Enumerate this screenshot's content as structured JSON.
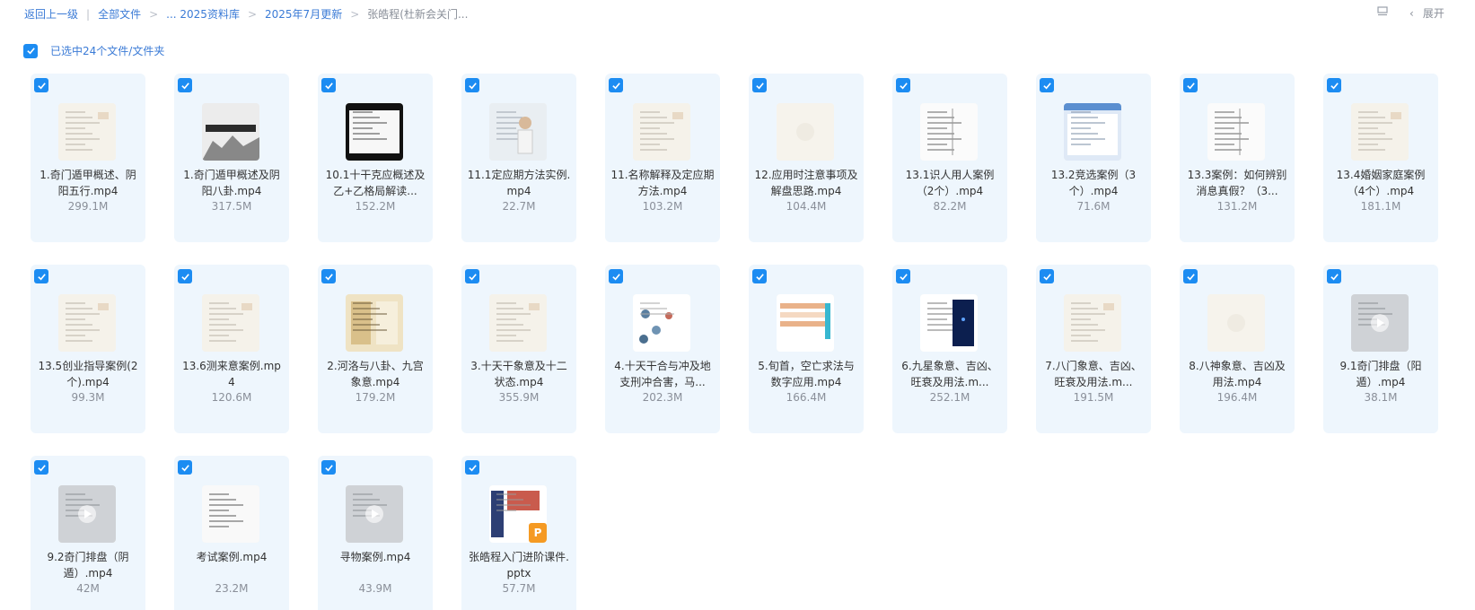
{
  "breadcrumb": {
    "back": "返回上一级",
    "items": [
      "全部文件",
      "... 2025资料库",
      "2025年7月更新"
    ],
    "current": "张皓程(杜新会关门..."
  },
  "toolbar": {
    "expand_label": "展开",
    "view_icon": "list-view-icon",
    "collapse_icon": "chevron-left-icon"
  },
  "selection": {
    "label": "已选中24个文件/文件夹"
  },
  "colors": {
    "accent": "#1c8cf2",
    "card_bg": "#eef6fd",
    "link": "#3b7bd6"
  },
  "files": [
    {
      "name": "1.奇门遁甲概述、阴阳五行.mp4",
      "size": "299.1M",
      "thumb": "doc"
    },
    {
      "name": "1.奇门遁甲概述及阴阳八卦.mp4",
      "size": "317.5M",
      "thumb": "title"
    },
    {
      "name": "10.1十干克应概述及乙+乙格局解读...",
      "size": "152.2M",
      "thumb": "dark"
    },
    {
      "name": "11.1定应期方法实例.mp4",
      "size": "22.7M",
      "thumb": "person"
    },
    {
      "name": "11.名称解释及定应期方法.mp4",
      "size": "103.2M",
      "thumb": "doc"
    },
    {
      "name": "12.应用时注意事项及解盘思路.mp4",
      "size": "104.4M",
      "thumb": "blank"
    },
    {
      "name": "13.1识人用人案例（2个）.mp4",
      "size": "82.2M",
      "thumb": "table"
    },
    {
      "name": "13.2竞选案例（3个）.mp4",
      "size": "71.6M",
      "thumb": "window"
    },
    {
      "name": "13.3案例：如何辨别消息真假？（3...",
      "size": "131.2M",
      "thumb": "table"
    },
    {
      "name": "13.4婚姻家庭案例（4个）.mp4",
      "size": "181.1M",
      "thumb": "doc"
    },
    {
      "name": "13.5创业指导案例(2个).mp4",
      "size": "99.3M",
      "thumb": "doc"
    },
    {
      "name": "13.6测来意案例.mp4",
      "size": "120.6M",
      "thumb": "doc"
    },
    {
      "name": "2.河洛与八卦、九宫象意.mp4",
      "size": "179.2M",
      "thumb": "tan"
    },
    {
      "name": "3.十天干象意及十二状态.mp4",
      "size": "355.9M",
      "thumb": "doc"
    },
    {
      "name": "4.十天干合与冲及地支刑冲合害，马...",
      "size": "202.3M",
      "thumb": "dots"
    },
    {
      "name": "5.旬首，空亡求法与数字应用.mp4",
      "size": "166.4M",
      "thumb": "colortable"
    },
    {
      "name": "6.九星象意、吉凶、旺衰及用法.m...",
      "size": "252.1M",
      "thumb": "navy"
    },
    {
      "name": "7.八门象意、吉凶、旺衰及用法.m...",
      "size": "191.5M",
      "thumb": "doc"
    },
    {
      "name": "8.八神象意、吉凶及用法.mp4",
      "size": "196.4M",
      "thumb": "blank"
    },
    {
      "name": "9.1奇门排盘（阳遁）.mp4",
      "size": "38.1M",
      "thumb": "gray"
    },
    {
      "name": "9.2奇门排盘（阴遁）.mp4",
      "size": "42M",
      "thumb": "gray"
    },
    {
      "name": "考试案例.mp4",
      "size": "23.2M",
      "thumb": "white"
    },
    {
      "name": "寻物案例.mp4",
      "size": "43.9M",
      "thumb": "gray"
    },
    {
      "name": "张皓程入门进阶课件.pptx",
      "size": "57.7M",
      "thumb": "ppt",
      "badge": "P"
    }
  ]
}
